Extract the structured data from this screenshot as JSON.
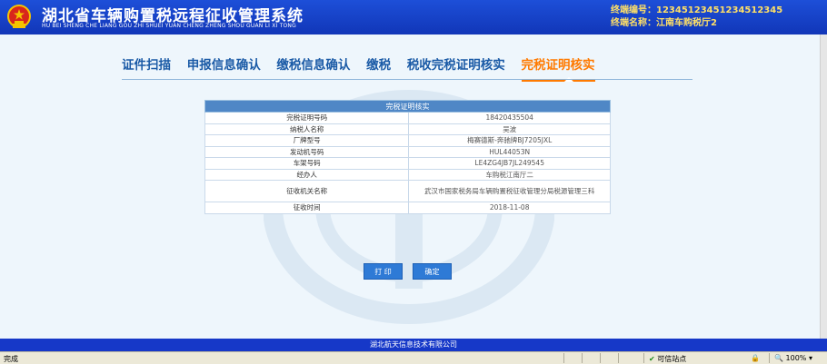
{
  "header": {
    "title": "湖北省车辆购置税远程征收管理系统",
    "title_pinyin": "HU BEI SHENG CHE LIANG GOU ZHI SHUEI YUAN CHENG ZHENG SHOU GUAN LI XI TONG",
    "terminal_no_label": "终端编号：",
    "terminal_no_value": "12345123451234512345",
    "terminal_name_label": "终端名称：",
    "terminal_name_value": "江南车购税厅2"
  },
  "tabs": [
    {
      "label": "证件扫描",
      "active": false
    },
    {
      "label": "申报信息确认",
      "active": false
    },
    {
      "label": "缴税信息确认",
      "active": false
    },
    {
      "label": "缴税",
      "active": false
    },
    {
      "label": "税收完税证明核实",
      "active": false
    },
    {
      "label": "完税证明核实",
      "active": true
    }
  ],
  "table": {
    "caption": "完税证明核实",
    "rows": [
      {
        "label": "完税证明号码",
        "value": "18420435504"
      },
      {
        "label": "纳税人名称",
        "value": "吴波"
      },
      {
        "label": "厂牌型号",
        "value": "梅赛德斯-奔驰牌BJ7205JXL"
      },
      {
        "label": "发动机号码",
        "value": "HUL44053N"
      },
      {
        "label": "车架号码",
        "value": "LE4ZG4JB7JL249545"
      },
      {
        "label": "经办人",
        "value": "车购税江南厅二"
      },
      {
        "label": "征收机关名称",
        "value": "武汉市国家税务局车辆购置税征收管理分局税源管理三科"
      },
      {
        "label": "征收时间",
        "value": "2018-11-08"
      }
    ]
  },
  "buttons": {
    "print": "打 印",
    "confirm": "确定"
  },
  "footer": {
    "company": "湖北航天信息技术有限公司"
  },
  "statusbar": {
    "status": "完成",
    "zone": "可信站点",
    "zoom": "100%"
  },
  "colors": {
    "header_bg": "#1d4fd8",
    "tab_text": "#1a5aa6",
    "tab_active": "#ff7a00",
    "table_header": "#4f87c6",
    "button_bg": "#2e7ad6",
    "footer_bg": "#1638c8"
  }
}
